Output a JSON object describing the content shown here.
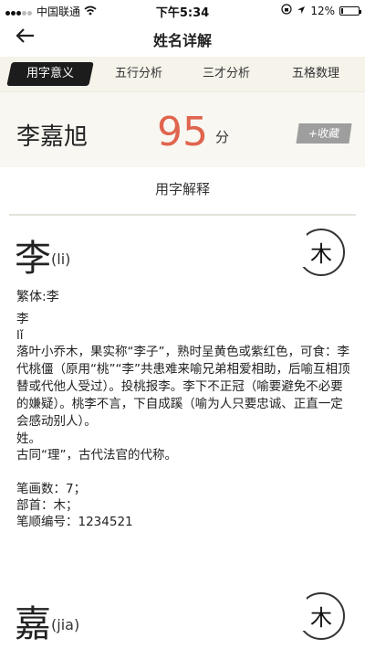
{
  "status": {
    "carrier": "中国联通",
    "time": "下午5:34",
    "battery": "12%",
    "battery_level": 0.12
  },
  "nav": {
    "title": "姓名详解"
  },
  "tabs": [
    "用字意义",
    "五行分析",
    "三才分析",
    "五格数理"
  ],
  "result": {
    "name": "李嘉旭",
    "score": "95",
    "unit": "分",
    "favorite": "+收藏"
  },
  "section": {
    "title": "用字解释"
  },
  "chars": [
    {
      "char": "李",
      "pinyin": "(li)",
      "element": "木",
      "traditional": "繁体:李",
      "lines": [
        "李",
        "lǐ",
        "落叶小乔木，果实称“李子”，熟时呈黄色或紫红色，可食：李代桃僵（原用“桃”“李”共患难来喻兄弟相爱相助，后喻互相顶替或代他人受过）。投桃报李。李下不正冠（喻要避免不必要的嫌疑）。桃李不言，下自成蹊（喻为人只要忠诚、正直一定会感动别人）。",
        "姓。",
        "古同“理”，古代法官的代称。"
      ],
      "stroke_count": "笔画数：7；",
      "radical": "部首：木；",
      "stroke_order": "笔顺编号：1234521"
    },
    {
      "char": "嘉",
      "pinyin": "(jia)",
      "element": "木"
    }
  ]
}
